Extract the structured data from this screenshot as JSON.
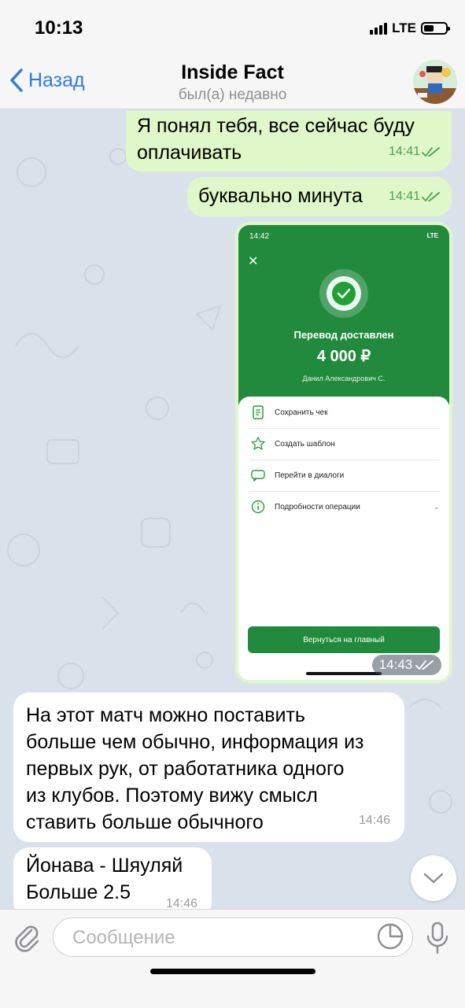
{
  "status_bar": {
    "time": "10:13",
    "network": "LTE"
  },
  "nav": {
    "back_label": "Назад",
    "title": "Inside Fact",
    "subtitle": "был(а) недавно"
  },
  "messages": [
    {
      "direction": "out",
      "lines": [
        "Я понял тебя, все сейчас буду",
        "оплачивать"
      ],
      "time": "14:41",
      "read": true
    },
    {
      "direction": "out",
      "lines": [
        "буквально минута"
      ],
      "time": "14:41",
      "read": true
    },
    {
      "direction": "out",
      "type": "photo",
      "time": "14:43",
      "read": true
    },
    {
      "direction": "in",
      "lines": [
        "На этот матч можно поставить",
        "больше чем обычно, информация из",
        "первых рук, от работатника одного",
        "из клубов. Поэтому вижу смысл",
        "ставить больше обычного"
      ],
      "time": "14:46"
    },
    {
      "direction": "in",
      "lines": [
        "Йонава - Шяуляй",
        "Больше 2.5"
      ],
      "time": "14:46"
    }
  ],
  "receipt": {
    "status_time": "14:42",
    "status_network": "LTE",
    "title": "Перевод доставлен",
    "amount": "4 000 ₽",
    "recipient": "Данил Александрович С.",
    "actions": [
      "Сохранить чек",
      "Создать шаблон",
      "Перейти в диалоги",
      "Подробности операции"
    ],
    "button": "Вернуться на главный",
    "accent": "#218a3d"
  },
  "input": {
    "placeholder": "Сообщение"
  },
  "icons": [
    "back-chevron-icon",
    "paperclip-icon",
    "sticker-icon",
    "microphone-icon",
    "chevron-down-icon",
    "double-check-icon"
  ],
  "colors": {
    "accent": "#2f7ae5",
    "outgoing_bubble": "#dff7c9",
    "incoming_bubble": "#ffffff",
    "read_tick": "#4aa351",
    "chat_bg": "#d9e2ea"
  }
}
